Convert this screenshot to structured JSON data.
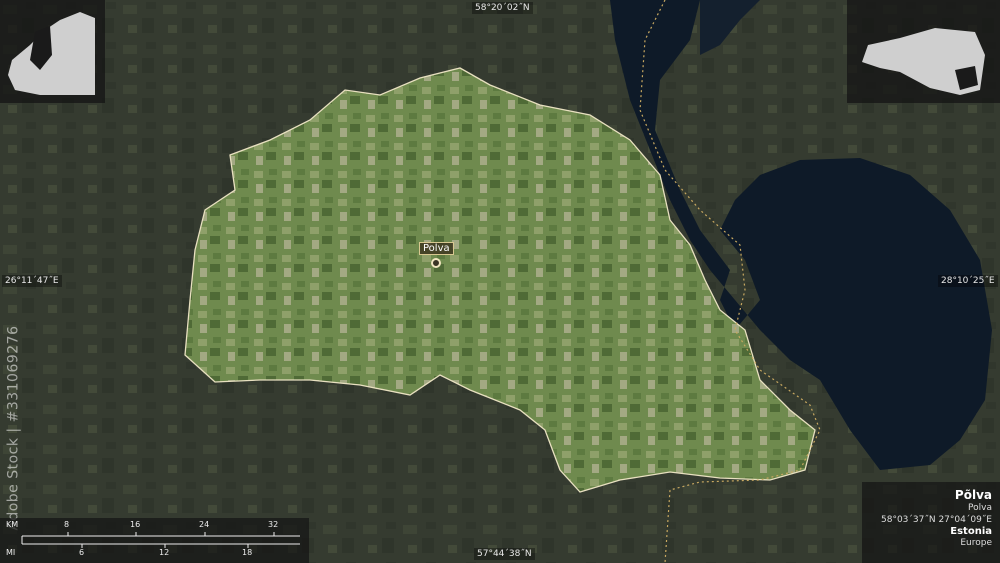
{
  "region": {
    "name": "Põlva",
    "local_name": "Polva",
    "coordinates": "58°03´37˝N 27°04´09˝E",
    "country": "Estonia",
    "continent": "Europe"
  },
  "city": {
    "label": "Polva"
  },
  "graticule": {
    "top": "58°20´02˝N",
    "bottom": "57°44´38˝N",
    "left": "26°11´47˝E",
    "right": "28°10´25˝E"
  },
  "scale_bar": {
    "km_unit": "KM",
    "km_ticks": [
      "8",
      "16",
      "24",
      "32"
    ],
    "mi_unit": "MI",
    "mi_ticks": [
      "6",
      "12",
      "18"
    ]
  },
  "watermark": "Adobe Stock | #331069276",
  "colors": {
    "region_fill": "#6f8a4e",
    "water": "#0e1a28",
    "background": "#353b30",
    "border": "#e8e0c0"
  }
}
